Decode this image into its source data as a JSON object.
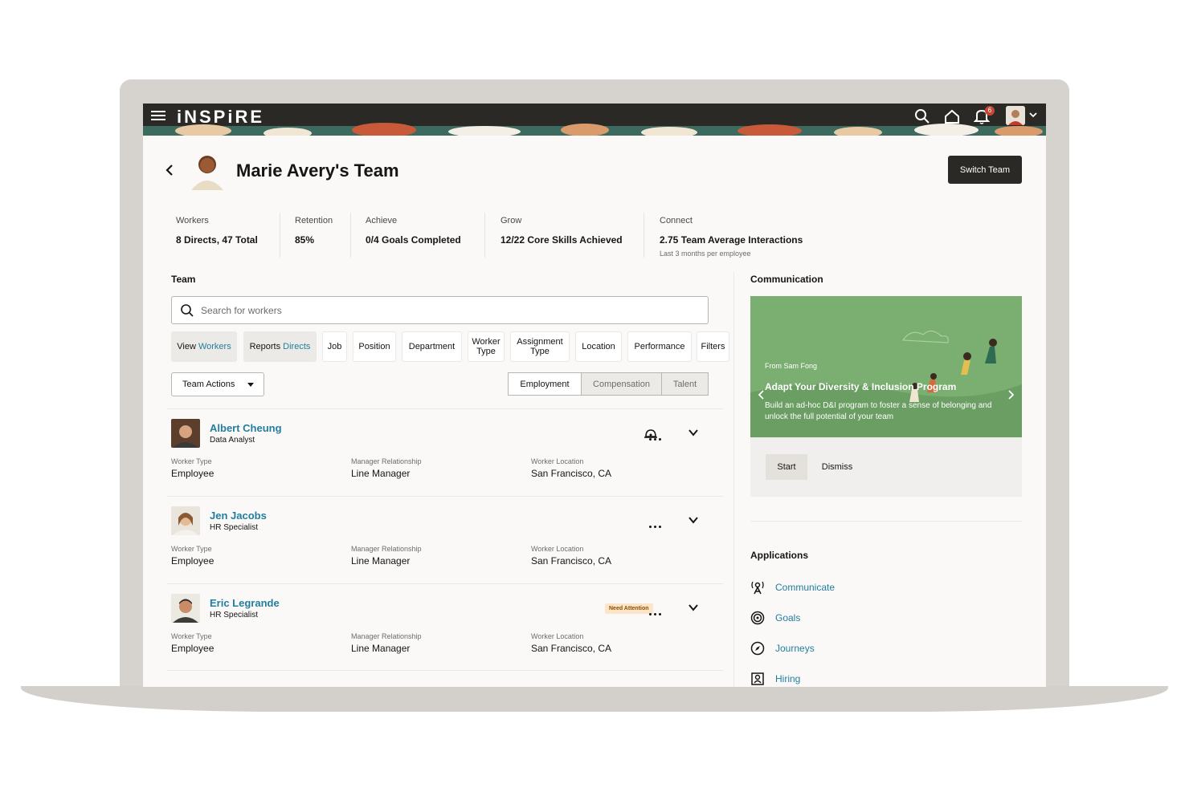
{
  "header": {
    "brand": "iNSPiRE",
    "notification_count": "6"
  },
  "page": {
    "title": "Marie Avery's Team",
    "switch_team_label": "Switch Team"
  },
  "metrics": [
    {
      "label": "Workers",
      "value": "8 Directs, 47 Total",
      "sub": ""
    },
    {
      "label": "Retention",
      "value": "85%",
      "sub": ""
    },
    {
      "label": "Achieve",
      "value": "0/4 Goals Completed",
      "sub": ""
    },
    {
      "label": "Grow",
      "value": "12/22 Core Skills Achieved",
      "sub": ""
    },
    {
      "label": "Connect",
      "value": "2.75 Team Average Interactions",
      "sub": "Last 3 months per employee"
    }
  ],
  "team": {
    "title": "Team",
    "search_placeholder": "Search for workers",
    "filters": [
      {
        "prefix": "View ",
        "accent": "Workers"
      },
      {
        "prefix": "Reports ",
        "accent": "Directs"
      },
      {
        "prefix": "Job",
        "accent": ""
      },
      {
        "prefix": "Position",
        "accent": ""
      },
      {
        "prefix": "Department",
        "accent": ""
      },
      {
        "prefix": "Worker Type",
        "accent": ""
      },
      {
        "prefix": "Assignment Type",
        "accent": ""
      },
      {
        "prefix": "Location",
        "accent": ""
      },
      {
        "prefix": "Performance",
        "accent": ""
      },
      {
        "prefix": "Filters",
        "accent": ""
      }
    ],
    "team_actions_label": "Team Actions",
    "view_tabs": [
      "Employment",
      "Compensation",
      "Talent"
    ],
    "selected_view_tab": "Employment",
    "field_labels": {
      "worker_type": "Worker Type",
      "manager_relationship": "Manager Relationship",
      "worker_location": "Worker Location"
    },
    "workers": [
      {
        "name": "Albert Cheung",
        "role": "Data Analyst",
        "worker_type": "Employee",
        "manager_relationship": "Line Manager",
        "worker_location": "San Francisco, CA",
        "badge": ""
      },
      {
        "name": "Jen Jacobs",
        "role": "HR Specialist",
        "worker_type": "Employee",
        "manager_relationship": "Line Manager",
        "worker_location": "San Francisco, CA",
        "badge": ""
      },
      {
        "name": "Eric Legrande",
        "role": "HR Specialist",
        "worker_type": "Employee",
        "manager_relationship": "Line Manager",
        "worker_location": "San Francisco, CA",
        "badge": "Need Attention"
      }
    ]
  },
  "communication": {
    "title": "Communication",
    "from": "From Sam Fong",
    "card_title": "Adapt Your Diversity & Inclusion Program",
    "card_desc": "Build an ad-hoc D&I program to foster a sense of belonging and unlock the full potential of your team",
    "start_label": "Start",
    "dismiss_label": "Dismiss"
  },
  "applications": {
    "title": "Applications",
    "items": [
      {
        "label": "Communicate",
        "icon": "communicate-icon"
      },
      {
        "label": "Goals",
        "icon": "goals-icon"
      },
      {
        "label": "Journeys",
        "icon": "journeys-icon"
      },
      {
        "label": "Hiring",
        "icon": "hiring-icon"
      }
    ]
  },
  "colors": {
    "header_bg": "#2b2926",
    "link": "#227e9e",
    "banner": "#7bae71",
    "primary_button": "#2b2926"
  }
}
